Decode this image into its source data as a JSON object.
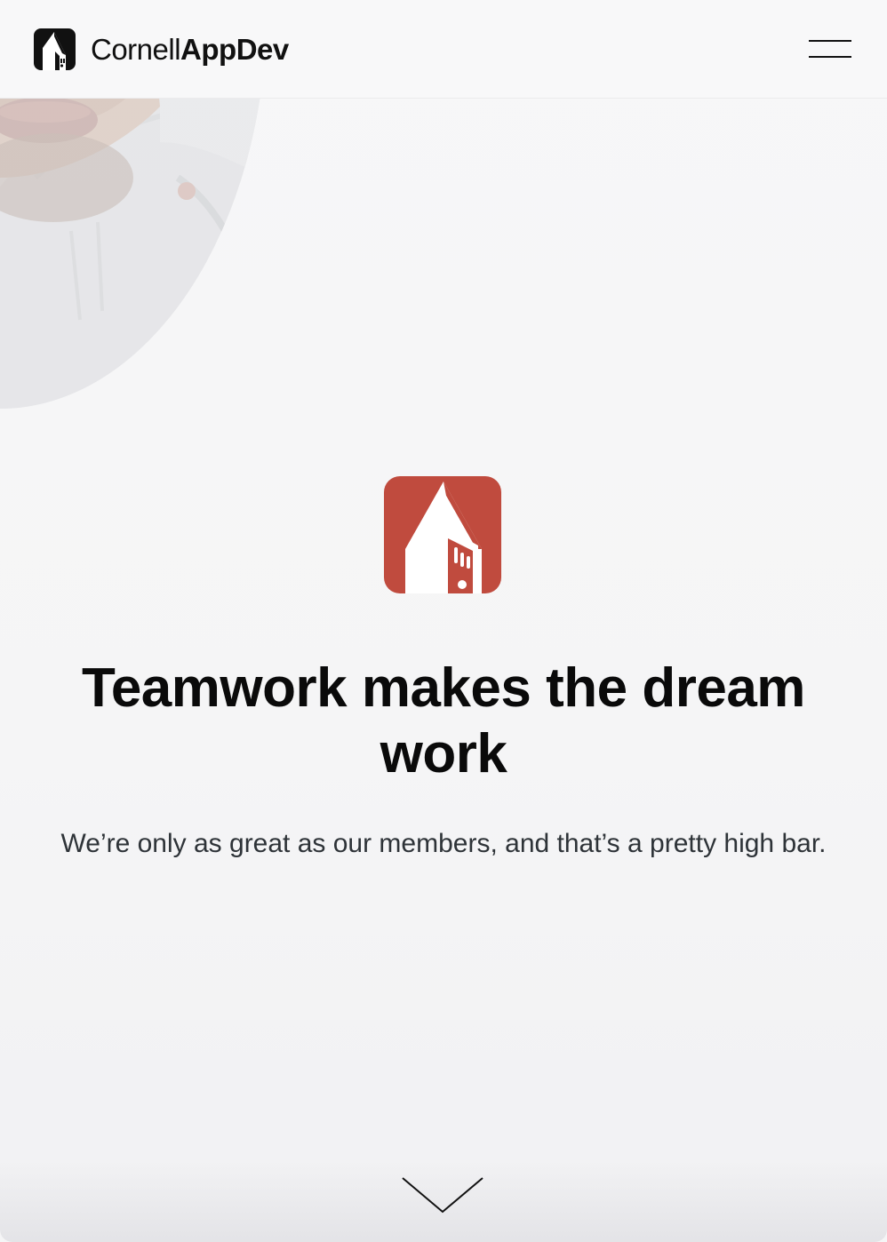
{
  "header": {
    "brand": {
      "text_light": "Cornell",
      "text_bold": "AppDev",
      "icon": "cornell-appdev-logo-icon"
    },
    "menu": {
      "icon": "hamburger-menu-icon"
    }
  },
  "hero": {
    "photo_icon": "member-photo",
    "logo_icon": "appdev-tower-icon",
    "headline": "Teamwork makes the dream work",
    "subhead": "We’re only as great as our members, and that’s a pretty high bar.",
    "scroll_icon": "chevron-down-icon"
  },
  "colors": {
    "accent": "#c04b3e",
    "text_dark": "#0a0a0a",
    "text_body": "#2e3338",
    "background": "#f5f5f6"
  }
}
